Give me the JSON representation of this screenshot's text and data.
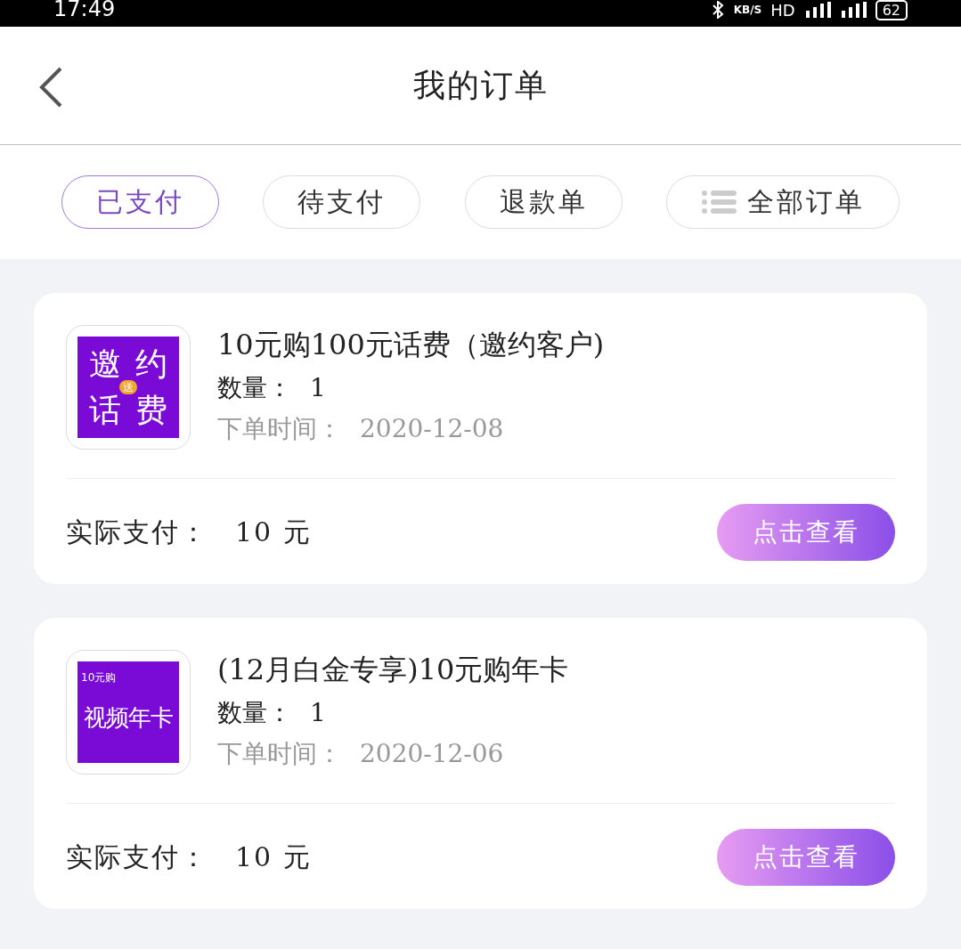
{
  "status_bar": {
    "time": "17:49",
    "speed_unit": "KB/S",
    "network": "HD",
    "battery": "62"
  },
  "header": {
    "title": "我的订单"
  },
  "tabs": [
    {
      "label": "已支付",
      "selected": true,
      "kind": "plain"
    },
    {
      "label": "待支付",
      "selected": false,
      "kind": "plain"
    },
    {
      "label": "退款单",
      "selected": false,
      "kind": "plain"
    },
    {
      "label": "全部订单",
      "selected": false,
      "kind": "list"
    }
  ],
  "orders": [
    {
      "thumbnail": {
        "kind": "badge",
        "lines": [
          "邀约",
          "话费"
        ],
        "badge": "送"
      },
      "title": "10元购100元话费（邀约客户)",
      "quantity_label": "数量：",
      "quantity": "1",
      "date_label": "下单时间：",
      "date": "2020-12-08",
      "paid_label": "实际支付：",
      "paid": "10 元",
      "button": "点击查看"
    },
    {
      "thumbnail": {
        "kind": "caption",
        "caption": "10元购",
        "lines": [
          "视频年卡"
        ]
      },
      "title": "(12月白金专享)10元购年卡",
      "quantity_label": "数量：",
      "quantity": "1",
      "date_label": "下单时间：",
      "date": "2020-12-06",
      "paid_label": "实际支付：",
      "paid": "10 元",
      "button": "点击查看"
    }
  ]
}
